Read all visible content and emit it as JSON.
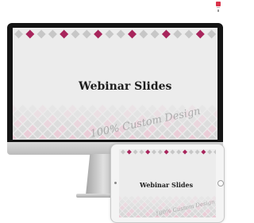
{
  "slide": {
    "title": "Webinar Slides",
    "script_text": "100% Custom Design"
  },
  "colors": {
    "accent": "#a8255c",
    "light_diamond": "#c7c7c7",
    "pink_diamond": "#e8b4c6",
    "screen_bg": "#ececec",
    "bezel": "#141414",
    "corner_badge": "#d9334a"
  },
  "icons": {
    "corner_badge": "flag-icon",
    "tablet_home": "home-button-icon"
  }
}
